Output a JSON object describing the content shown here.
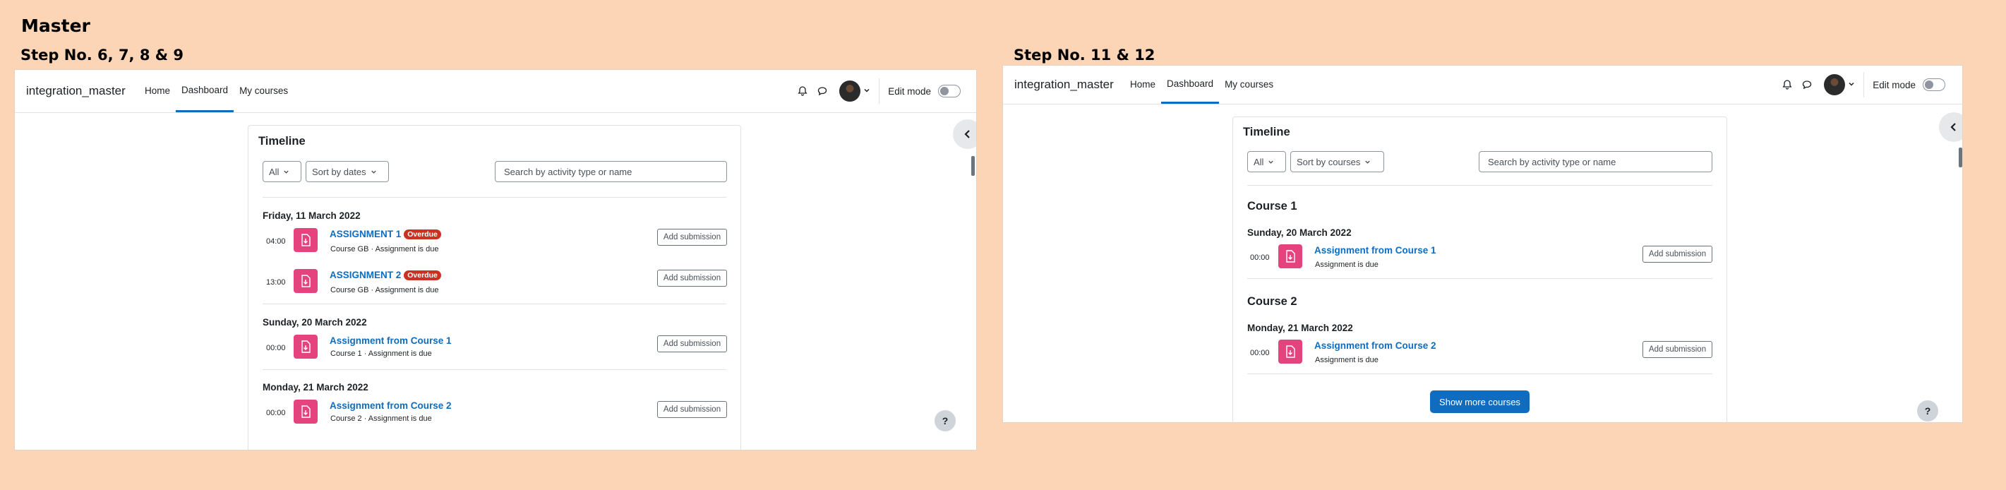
{
  "heading": "Master",
  "panels": [
    {
      "step_label": "Step No. 6, 7, 8 & 9",
      "brand": "integration_master",
      "nav": [
        "Home",
        "Dashboard",
        "My courses"
      ],
      "edit_mode": "Edit mode",
      "help": "?",
      "timeline": {
        "title": "Timeline",
        "filter": "All",
        "sort": "Sort by dates",
        "search_placeholder": "Search by activity type or name",
        "groups": [
          {
            "date": "Friday, 11 March 2022",
            "events": [
              {
                "time": "04:00",
                "name": "ASSIGNMENT 1",
                "badge": "Overdue",
                "sub": "Course GB · Assignment is due",
                "action": "Add submission"
              },
              {
                "time": "13:00",
                "name": "ASSIGNMENT 2",
                "badge": "Overdue",
                "sub": "Course GB · Assignment is due",
                "action": "Add submission"
              }
            ]
          },
          {
            "date": "Sunday, 20 March 2022",
            "events": [
              {
                "time": "00:00",
                "name": "Assignment from Course 1",
                "sub": "Course 1 · Assignment is due",
                "action": "Add submission"
              }
            ]
          },
          {
            "date": "Monday, 21 March 2022",
            "events": [
              {
                "time": "00:00",
                "name": "Assignment from Course 2",
                "sub": "Course 2 · Assignment is due",
                "action": "Add submission"
              }
            ]
          }
        ]
      }
    },
    {
      "step_label": "Step No. 11 & 12",
      "brand": "integration_master",
      "nav": [
        "Home",
        "Dashboard",
        "My courses"
      ],
      "edit_mode": "Edit mode",
      "help": "?",
      "timeline": {
        "title": "Timeline",
        "filter": "All",
        "sort": "Sort by courses",
        "search_placeholder": "Search by activity type or name",
        "courses": [
          {
            "name": "Course 1",
            "date": "Sunday, 20 March 2022",
            "event": {
              "time": "00:00",
              "name": "Assignment from Course 1",
              "sub": "Assignment is due",
              "action": "Add submission"
            }
          },
          {
            "name": "Course 2",
            "date": "Monday, 21 March 2022",
            "event": {
              "time": "00:00",
              "name": "Assignment from Course 2",
              "sub": "Assignment is due",
              "action": "Add submission"
            }
          }
        ],
        "show_more": "Show more courses"
      }
    }
  ],
  "colors": {
    "accent": "#0f6cbf",
    "overdue": "#ca3120",
    "assign_icon": "#e5437e",
    "background": "#fbd5b5"
  }
}
